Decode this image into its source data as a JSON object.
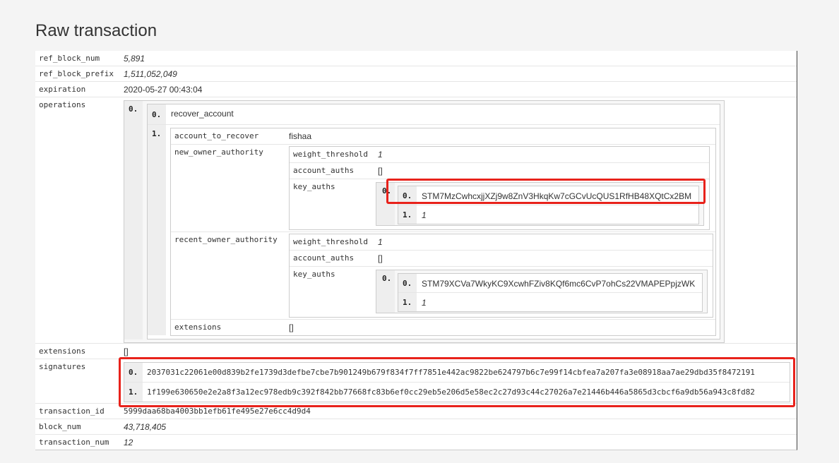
{
  "page": {
    "title": "Raw transaction"
  },
  "tx": {
    "ref_block_num": {
      "key": "ref_block_num",
      "value": "5,891"
    },
    "ref_block_prefix": {
      "key": "ref_block_prefix",
      "value": "1,511,052,049"
    },
    "expiration": {
      "key": "expiration",
      "value": "2020-05-27 00:43:04"
    },
    "operations": {
      "key": "operations",
      "idx0": "0.",
      "op_index0": "0.",
      "op_name": "recover_account",
      "op_index1": "1.",
      "account_to_recover": {
        "key": "account_to_recover",
        "value": "fishaa"
      },
      "new_owner_authority": {
        "key": "new_owner_authority",
        "weight_threshold": {
          "key": "weight_threshold",
          "value": "1"
        },
        "account_auths": {
          "key": "account_auths",
          "value": "[]"
        },
        "key_auths": {
          "key": "key_auths",
          "outer_idx": "0.",
          "idx0": "0.",
          "pubkey": "STM7MzCwhcxjjXZj9w8ZnV3HkqKw7cGCvUcQUS1RfHB48XQtCx2BM",
          "idx1": "1.",
          "weight": "1"
        }
      },
      "recent_owner_authority": {
        "key": "recent_owner_authority",
        "weight_threshold": {
          "key": "weight_threshold",
          "value": "1"
        },
        "account_auths": {
          "key": "account_auths",
          "value": "[]"
        },
        "key_auths": {
          "key": "key_auths",
          "outer_idx": "0.",
          "idx0": "0.",
          "pubkey": "STM79XCVa7WkyKC9XcwhFZiv8KQf6mc6CvP7ohCs22VMAPEPpjzWK",
          "idx1": "1.",
          "weight": "1"
        }
      },
      "extensions": {
        "key": "extensions",
        "value": "[]"
      }
    },
    "extensions": {
      "key": "extensions",
      "value": "[]"
    },
    "signatures": {
      "key": "signatures",
      "items": [
        {
          "idx": "0.",
          "value": "2037031c22061e00d839b2fe1739d3defbe7cbe7b901249b679f834f7ff7851e442ac9822be624797b6c7e99f14cbfea7a207fa3e08918aa7ae29dbd35f8472191"
        },
        {
          "idx": "1.",
          "value": "1f199e630650e2e2a8f3a12ec978edb9c392f842bb77668fc83b6ef0cc29eb5e206d5e58ec2c27d93c44c27026a7e21446b446a5865d3cbcf6a9db56a943c8fd82"
        }
      ]
    },
    "transaction_id": {
      "key": "transaction_id",
      "value": "5999daa68ba4003bb1efb61fe495e27e6cc4d9d4"
    },
    "block_num": {
      "key": "block_num",
      "value": "43,718,405"
    },
    "transaction_num": {
      "key": "transaction_num",
      "value": "12"
    }
  }
}
